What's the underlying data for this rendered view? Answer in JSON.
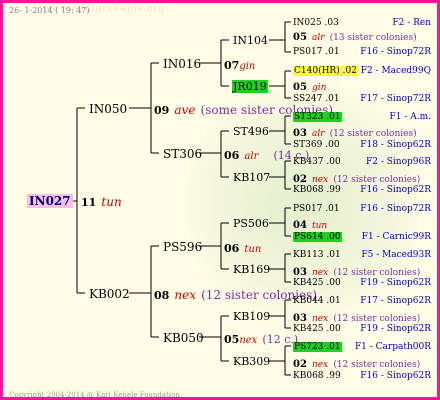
{
  "header": {
    "date": "26- 1-2014 ( 19: 47)"
  },
  "footer": {
    "copyright": "Copyright 2004-2014 @ Karl Kehele Foundation."
  },
  "watermark": {
    "text": "www.pedigreeapis.org"
  },
  "colors": {
    "border": "#ff1493",
    "background": "#fffde6",
    "race": "#cc0000",
    "note": "#7a2fa6",
    "location": "#0000cc",
    "highlight_green": "#20d020",
    "highlight_yellow": "#ffff33",
    "root_highlight": "#f6c1e3"
  },
  "root": {
    "id": "IN027",
    "year": "11",
    "race": "tun"
  },
  "gen1": {
    "top": {
      "id": "IN050",
      "year": "09",
      "race": "ave",
      "note": "(some sister colonies)"
    },
    "bottom": {
      "id": "KB002",
      "year": "08",
      "race": "nex",
      "note": "(12 sister colonies)"
    }
  },
  "gen2": {
    "a": {
      "id": "IN016",
      "year": "07",
      "race": "gin"
    },
    "b": {
      "id": "ST306",
      "year": "06",
      "race": "alr",
      "note": "(14 c.)"
    },
    "c": {
      "id": "PS596",
      "year": "06",
      "race": "tun"
    },
    "d": {
      "id": "KB050",
      "year": "05",
      "race": "nex",
      "note": "(12 c.)"
    }
  },
  "gen3": {
    "a1": "IN104",
    "a2": "JR019",
    "b1": "ST496",
    "b2": "KB107",
    "c1": "PS506",
    "c2": "KB169",
    "d1": "KB109",
    "d2": "KB309"
  },
  "gen4": [
    {
      "id": "IN025",
      "year": ".03",
      "loc": "F2 - Ren"
    },
    {
      "year": "05",
      "race": "alr",
      "note": "(13 sister colonies)"
    },
    {
      "id": "PS017",
      "year": ".01",
      "loc": "F16 - Sinop72R"
    },
    {
      "id": "C140(HR)",
      "year": ".02",
      "loc": "F2 - Maced99Q"
    },
    {
      "year": "05",
      "race": "gin"
    },
    {
      "id": "SS247",
      "year": ".01",
      "loc": "F17 - Sinop72R"
    },
    {
      "id": "ST323",
      "year": ".01",
      "loc": "F1 - A.m."
    },
    {
      "year": "03",
      "race": "alr",
      "note": "(12 sister colonies)"
    },
    {
      "id": "ST369",
      "year": ".00",
      "loc": "F18 - Sinop62R"
    },
    {
      "id": "KB437",
      "year": ".00",
      "loc": "F2 - Sinop96R"
    },
    {
      "year": "02",
      "race": "nex",
      "note": "(12 sister colonies)"
    },
    {
      "id": "KB068",
      "year": ".99",
      "loc": "F16 - Sinop62R"
    },
    {
      "id": "PS017",
      "year": ".01",
      "loc": "F16 - Sinop72R"
    },
    {
      "year": "04",
      "race": "tun"
    },
    {
      "id": "PS614",
      "year": ".00",
      "loc": "F1 - Carnic99R"
    },
    {
      "id": "KB113",
      "year": ".01",
      "loc": "F5 - Maced93R"
    },
    {
      "year": "03",
      "race": "nex",
      "note": "(12 sister colonies)"
    },
    {
      "id": "KB425",
      "year": ".00",
      "loc": "F19 - Sinop62R"
    },
    {
      "id": "KB044",
      "year": ".01",
      "loc": "F17 - Sinop62R"
    },
    {
      "year": "03",
      "race": "nex",
      "note": "(12 sister colonies)"
    },
    {
      "id": "KB425",
      "year": ".00",
      "loc": "F19 - Sinop62R"
    },
    {
      "id": "PS723",
      "year": ".01",
      "loc": "F1 - Carpath00R"
    },
    {
      "year": "02",
      "race": "nex",
      "note": "(12 sister colonies)"
    },
    {
      "id": "KB068",
      "year": ".99",
      "loc": "F16 - Sinop62R"
    }
  ]
}
